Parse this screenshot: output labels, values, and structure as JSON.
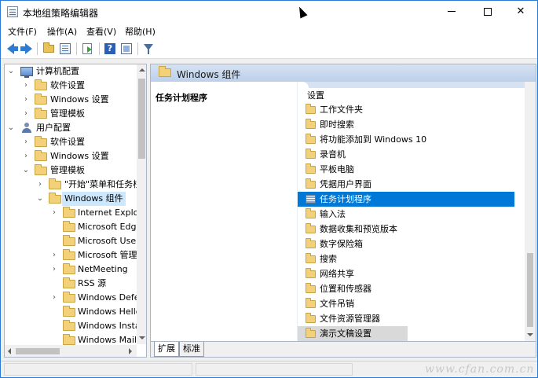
{
  "window": {
    "title": "本地组策略编辑器"
  },
  "menu": [
    {
      "label": "文件(F)"
    },
    {
      "label": "操作(A)"
    },
    {
      "label": "查看(V)"
    },
    {
      "label": "帮助(H)"
    }
  ],
  "tree": [
    {
      "label": "计算机配置",
      "icon": "computer-icon",
      "expanded": true
    },
    {
      "label": "软件设置",
      "icon": "folder-icon"
    },
    {
      "label": "Windows 设置",
      "icon": "folder-icon"
    },
    {
      "label": "管理模板",
      "icon": "folder-icon"
    },
    {
      "label": "用户配置",
      "icon": "user-icon",
      "expanded": true
    },
    {
      "label": "软件设置",
      "icon": "folder-icon"
    },
    {
      "label": "Windows 设置",
      "icon": "folder-icon"
    },
    {
      "label": "管理模板",
      "icon": "folder-icon",
      "expanded": true
    },
    {
      "label": "\"开始\"菜单和任务栏",
      "icon": "folder-icon"
    },
    {
      "label": "Windows 组件",
      "icon": "folder-icon",
      "expanded": true,
      "selected": true
    },
    {
      "label": "Internet Explorer",
      "icon": "folder-icon"
    },
    {
      "label": "Microsoft Edge",
      "icon": "folder-icon"
    },
    {
      "label": "Microsoft User Experience Virtualization",
      "icon": "folder-icon"
    },
    {
      "label": "Microsoft 管理控制台",
      "icon": "folder-icon"
    },
    {
      "label": "NetMeeting",
      "icon": "folder-icon"
    },
    {
      "label": "RSS 源",
      "icon": "folder-icon"
    },
    {
      "label": "Windows Defender",
      "icon": "folder-icon"
    },
    {
      "label": "Windows Hello 企业版",
      "icon": "folder-icon"
    },
    {
      "label": "Windows Installer",
      "icon": "folder-icon"
    },
    {
      "label": "Windows Mail",
      "icon": "folder-icon"
    }
  ],
  "content": {
    "header": "Windows 组件",
    "selected_title": "任务计划程序",
    "column_header": "设置",
    "items": [
      {
        "label": "工作文件夹",
        "icon": "folder-icon"
      },
      {
        "label": "即时搜索",
        "icon": "folder-icon"
      },
      {
        "label": "将功能添加到 Windows 10",
        "icon": "folder-icon"
      },
      {
        "label": "录音机",
        "icon": "folder-icon"
      },
      {
        "label": "平板电脑",
        "icon": "folder-icon"
      },
      {
        "label": "凭据用户界面",
        "icon": "folder-icon"
      },
      {
        "label": "任务计划程序",
        "icon": "setting-icon",
        "selected": true
      },
      {
        "label": "输入法",
        "icon": "folder-icon"
      },
      {
        "label": "数据收集和预览版本",
        "icon": "folder-icon"
      },
      {
        "label": "数字保险箱",
        "icon": "folder-icon"
      },
      {
        "label": "搜索",
        "icon": "folder-icon"
      },
      {
        "label": "网络共享",
        "icon": "folder-icon"
      },
      {
        "label": "位置和传感器",
        "icon": "folder-icon"
      },
      {
        "label": "文件吊销",
        "icon": "folder-icon"
      },
      {
        "label": "文件资源管理器",
        "icon": "folder-icon"
      },
      {
        "label": "演示文稿设置",
        "icon": "folder-icon"
      }
    ]
  },
  "tabs": [
    {
      "label": "扩展",
      "active": true
    },
    {
      "label": "标准",
      "active": false
    }
  ],
  "watermark": "www.cfan.com.cn",
  "colors": {
    "selection": "#0078d7",
    "tree_selection": "#cce8ff",
    "header_band": "#bcd0ea",
    "folder": "#f3d17a"
  }
}
